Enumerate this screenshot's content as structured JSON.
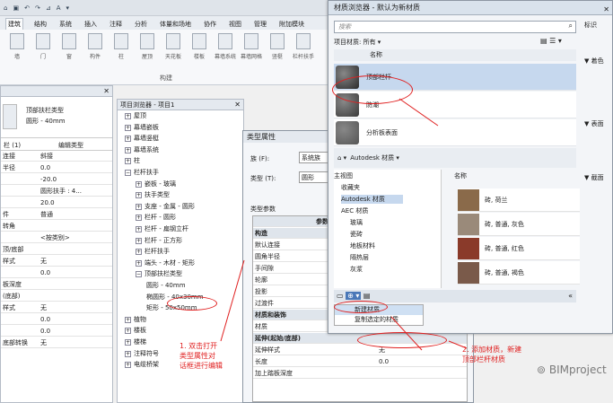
{
  "quick_access": {
    "tabs": [
      "建筑",
      "结构",
      "系统",
      "插入",
      "注释",
      "分析",
      "体量和场地",
      "协作",
      "视图",
      "管理",
      "附加模块"
    ]
  },
  "ribbon": {
    "buttons": [
      "墙",
      "门",
      "窗",
      "构件",
      "柱",
      "屋顶",
      "天花板",
      "楼板",
      "幕墙系统",
      "幕墙网格",
      "竖梃",
      "栏杆扶手"
    ],
    "panel_label": "构建"
  },
  "properties": {
    "type_name": "顶部扶栏类型",
    "type_sub": "圆形 - 40mm",
    "instance_sel": "栏 (1)",
    "edit_type": "编辑类型",
    "rows": [
      [
        "连接",
        "斜接"
      ],
      [
        "半径",
        "0.0"
      ],
      [
        "",
        "-20.0"
      ],
      [
        "",
        "圆形扶手 : 4..."
      ],
      [
        "",
        "20.0"
      ],
      [
        "件",
        "普通"
      ],
      [
        "转角",
        ""
      ],
      [
        "",
        "<按类别>"
      ],
      [
        "顶/底部",
        ""
      ],
      [
        "样式",
        "无"
      ],
      [
        "",
        "0.0"
      ],
      [
        "板深度",
        ""
      ],
      [
        "(底部)",
        ""
      ],
      [
        "样式",
        "无"
      ],
      [
        "",
        "0.0"
      ],
      [
        "",
        "0.0"
      ],
      [
        "底部转换",
        "无"
      ]
    ]
  },
  "browser": {
    "title": "项目浏览器 - 项目1",
    "items": [
      "屋顶",
      "幕墙嵌板",
      "幕墙竖梃",
      "幕墙系统",
      "柱",
      "栏杆扶手",
      "嵌板 - 玻璃",
      "扶手类型",
      "支座 - 金属 - 圆形",
      "栏杆 - 圆形",
      "栏杆 - 扁钢立杆",
      "栏杆 - 正方形",
      "栏杆扶手",
      "端头 - 木材 - 矩形",
      "顶部扶栏类型",
      "圆形 - 40mm",
      "椭圆形 - 40x30mm",
      "矩形 - 50x50mm",
      "植物",
      "楼板",
      "楼梯",
      "注释符号",
      "电缆桥架"
    ]
  },
  "type_dialog": {
    "title": "类型属性",
    "family_label": "族 (F):",
    "family_value": "系统族",
    "type_label": "类型 (T):",
    "type_value": "圆形",
    "params_title": "类型参数",
    "param_header": "参数",
    "group_construction": "构造",
    "params": [
      "默认连接",
      "圆角半径",
      "手间隙",
      "轮廓",
      "投影",
      "过渡件"
    ],
    "group_material": "材质和装饰",
    "material_label": "材质",
    "material_value": "<按类别>",
    "group_extension": "延伸(起始/底部)",
    "ext_rows": [
      [
        "延伸样式",
        "无"
      ],
      [
        "长度",
        "0.0"
      ],
      [
        "加上踏板深度",
        ""
      ]
    ]
  },
  "material_browser": {
    "title": "材质浏览器 - 默认为新材质",
    "search_placeholder": "搜索",
    "filter_label": "项目材质: 所有 ▾",
    "col_name": "名称",
    "project_materials": [
      "顶部栏杆",
      "防潮",
      "分析板表面"
    ],
    "right_tabs": [
      "标识",
      "▼ 着色",
      "▼ 表面",
      "▼ 截面"
    ],
    "lib_path": "Autodesk 材质 ▾",
    "tree": [
      "主视图",
      "收藏夹",
      "Autodesk 材质",
      "AEC 材质",
      "玻璃",
      "瓷砖",
      "地板材料",
      "隔热层",
      "灰浆"
    ],
    "lib_col": "名称",
    "library": [
      "砖, 荷兰",
      "砖, 普通, 灰色",
      "砖, 普通, 红色",
      "砖, 普通, 褐色"
    ],
    "menu": [
      "新建材质",
      "复制选定的材质"
    ]
  },
  "notes": {
    "note1": "1. 双击打开\n类型属性对\n话框进行编辑",
    "note2": "2. 添加材质，新建\n顶部栏杆材质"
  },
  "watermark": "BIMproject"
}
